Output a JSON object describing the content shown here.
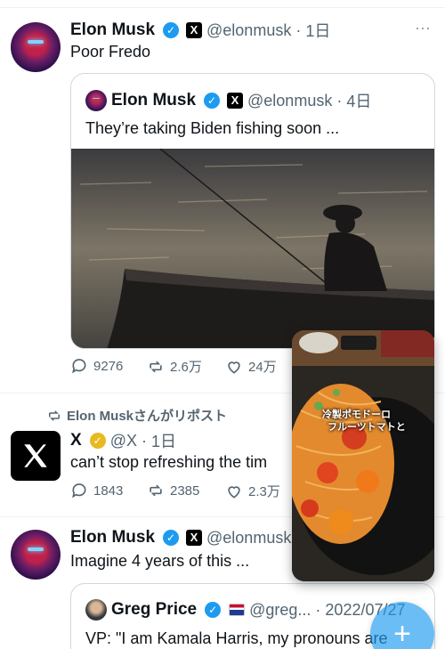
{
  "post1": {
    "name": "Elon Musk",
    "handle": "@elonmusk",
    "time": "1日",
    "text": "Poor Fredo",
    "more": "···",
    "avatar_icon": "profile-avatar",
    "quote": {
      "name": "Elon Musk",
      "handle": "@elonmusk",
      "time": "4日",
      "text": "They’re taking Biden fishing soon ...",
      "image_icon": "fishing-boat-photo"
    },
    "actions": {
      "replies": "9276",
      "reposts": "2.6万",
      "likes": "24万"
    }
  },
  "post2": {
    "repost_label": "Elon Muskさんがリポスト",
    "name": "X",
    "handle": "@X",
    "time": "1日",
    "text": "can’t stop refreshing the tim",
    "avatar_icon": "x-logo",
    "actions": {
      "replies": "1843",
      "reposts": "2385",
      "likes": "2.3万"
    }
  },
  "post3": {
    "name": "Elon Musk",
    "handle": "@elonmusk",
    "time": "",
    "text": "Imagine 4 years of this ...",
    "quote": {
      "name": "Greg Price",
      "handle": "@greg...",
      "time": "2022/07/27",
      "text": "VP: \"I am Kamala Harris, my pronouns are"
    }
  },
  "overlay": {
    "label_line1": "冷製ポモドーロ",
    "label_line2": "フルーツトマトと"
  },
  "fab": {
    "label": "+"
  },
  "colors": {
    "accent": "#1d9bf0",
    "text": "#0f1419",
    "muted": "#536471",
    "gold": "#e8b923"
  }
}
